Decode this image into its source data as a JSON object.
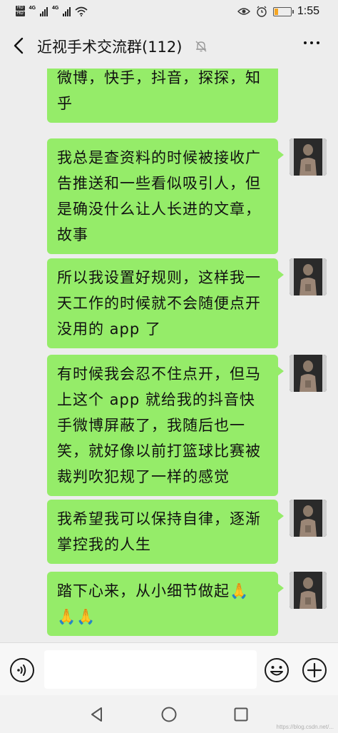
{
  "status_bar": {
    "network_tag_1": "HD",
    "network_tag_2": "HD",
    "network_type_1": "4G",
    "network_type_2": "4G",
    "time": "1:55",
    "battery_level": 0.25
  },
  "header": {
    "title": "近视手术交流群(112)",
    "icons": [
      "back-arrow-icon",
      "mute-bell-icon",
      "more-icon"
    ]
  },
  "messages": [
    {
      "text": "微博，快手，抖音，探探，知乎",
      "sender": "self"
    },
    {
      "text": "我总是查资料的时候被接收广告推送和一些看似吸引人，但是确没什么让人长进的文章，故事",
      "sender": "self"
    },
    {
      "text": "所以我设置好规则，这样我一天工作的时候就不会随便点开没用的 app 了",
      "sender": "self"
    },
    {
      "text": "有时候我会忍不住点开，但马上这个 app 就给我的抖音快手微博屏蔽了，我随后也一笑，就好像以前打篮球比赛被裁判吹犯规了一样的感觉",
      "sender": "self"
    },
    {
      "text": "我希望我可以保持自律，逐渐掌控我的人生",
      "sender": "self"
    },
    {
      "text": "踏下心来，从小细节做起🙏🙏🙏",
      "sender": "self"
    }
  ],
  "input_bar": {
    "placeholder": "",
    "icons": [
      "voice-icon",
      "emoji-icon",
      "plus-icon"
    ]
  },
  "nav_bar": {
    "icons": [
      "nav-back-icon",
      "nav-home-icon",
      "nav-recent-icon"
    ]
  },
  "watermark": "https://blog.csdn.net/..."
}
